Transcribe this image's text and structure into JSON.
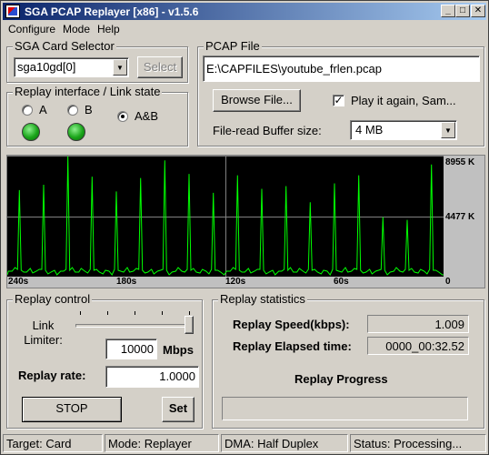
{
  "window": {
    "title": "SGA PCAP Replayer [x86] - v1.5.6"
  },
  "menu": {
    "configure": "Configure",
    "mode": "Mode",
    "help": "Help"
  },
  "card_selector": {
    "title": "SGA Card Selector",
    "selected": "sga10gd[0]",
    "select_label": "Select"
  },
  "replay_interface": {
    "title": "Replay interface / Link state",
    "options": [
      "A",
      "B",
      "A&B"
    ],
    "selected": "A&B"
  },
  "pcap_file": {
    "title": "PCAP File",
    "path": "E:\\CAPFILES\\youtube_frlen.pcap",
    "browse_label": "Browse File...",
    "play_again_label": "Play it again, Sam...",
    "play_again_checked": true,
    "buffer_label": "File-read Buffer size:",
    "buffer_value": "4 MB"
  },
  "chart_data": {
    "type": "line",
    "x_tick_labels": [
      "240s",
      "180s",
      "120s",
      "60s",
      "0"
    ],
    "y_tick_labels": [
      "8955 K",
      "4477 K",
      "0"
    ],
    "ylim": [
      0,
      8955
    ],
    "grid": true,
    "line_color": "#00ff00",
    "peaks": [
      6400,
      6800,
      8900,
      7400,
      6300,
      7300,
      8600,
      7600,
      6200,
      7500,
      6500,
      6700,
      5500,
      6900,
      7500,
      4400,
      4200,
      8300
    ]
  },
  "replay_control": {
    "title": "Replay control",
    "link_limiter_label": "Link\nLimiter:",
    "link_limiter_value": "10000",
    "link_limiter_unit": "Mbps",
    "slider_fraction": 1.0,
    "replay_rate_label": "Replay rate:",
    "replay_rate_value": "1.0000",
    "stop_label": "STOP",
    "set_label": "Set"
  },
  "replay_statistics": {
    "title": "Replay statistics",
    "speed_label": "Replay Speed(kbps):",
    "speed_value": "1.009",
    "elapsed_label": "Replay Elapsed time:",
    "elapsed_value": "0000_00:32.52",
    "progress_label": "Replay Progress",
    "progress_fraction": 0
  },
  "status": {
    "target": "Target: Card",
    "mode": "Mode: Replayer",
    "dma": "DMA: Half Duplex",
    "state": "Status: Processing..."
  }
}
